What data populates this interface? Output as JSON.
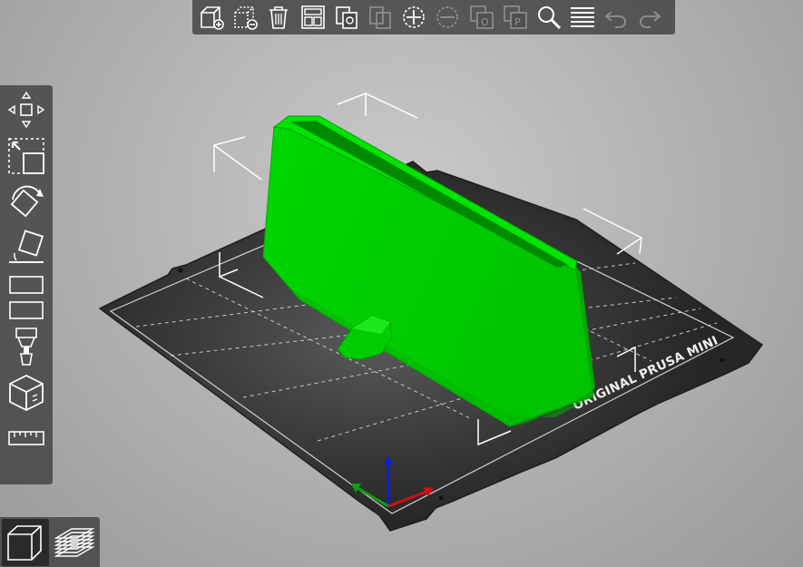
{
  "window": {
    "bed_label": "ORIGINAL PRUSA MINI",
    "accent_color": "#00d000",
    "bed_color": "#2d2d2d",
    "background_color": "#b8b8b8"
  },
  "toolbar_top": {
    "buttons": [
      {
        "name": "add-icon",
        "enabled": true
      },
      {
        "name": "delete-icon",
        "enabled": true
      },
      {
        "name": "delete-all-icon",
        "enabled": true
      },
      {
        "name": "arrange-icon",
        "enabled": true
      },
      {
        "name": "copy-icon",
        "enabled": true
      },
      {
        "name": "paste-icon",
        "enabled": false
      },
      {
        "name": "add-instance-icon",
        "enabled": true
      },
      {
        "name": "remove-instance-icon",
        "enabled": false
      },
      {
        "name": "split-objects-icon",
        "enabled": false
      },
      {
        "name": "split-parts-icon",
        "enabled": false
      },
      {
        "name": "search-icon",
        "enabled": true
      },
      {
        "name": "layers-editing-icon",
        "enabled": true
      },
      {
        "name": "undo-icon",
        "enabled": false
      },
      {
        "name": "redo-icon",
        "enabled": false
      }
    ]
  },
  "toolbar_left": {
    "tools": [
      "move-icon",
      "scale-icon",
      "rotate-icon",
      "place-on-face-icon",
      "cut-icon",
      "support-painting-icon",
      "seam-painting-icon",
      "measure-icon"
    ]
  },
  "view_toggle": {
    "active": "3d-view-icon",
    "items": [
      "3d-view-icon",
      "preview-layers-icon"
    ]
  }
}
